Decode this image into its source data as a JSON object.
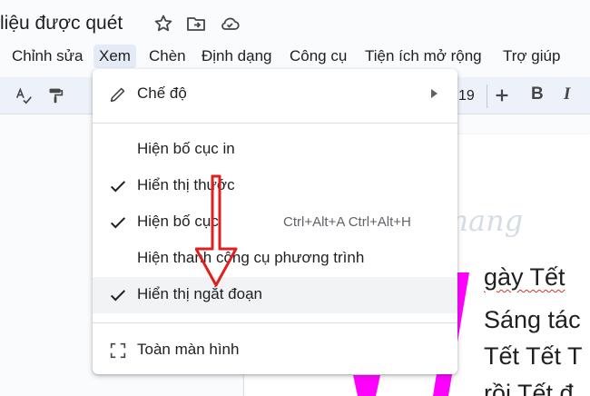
{
  "document": {
    "title": "liệu được quét"
  },
  "menubar": {
    "items": [
      "Chỉnh sửa",
      "Xem",
      "Chèn",
      "Định dạng",
      "Công cụ",
      "Tiện ích mở rộng",
      "Trợ giúp"
    ]
  },
  "toolbar": {
    "font_size": "19",
    "bold_label": "B",
    "italic_label": "I"
  },
  "view_menu": {
    "mode_label": "Chế độ",
    "print_layout_label": "Hiện bố cục in",
    "ruler_label": "Hiển thị thước",
    "ruler_checked": true,
    "layout_label": "Hiện bố cục",
    "layout_checked": true,
    "layout_shortcut": "Ctrl+Alt+A Ctrl+Alt+H",
    "equation_toolbar_label": "Hiện thanh công cụ phương trình",
    "non_printing_label": "Hiển thị ngắt đoạn",
    "non_printing_checked": true,
    "fullscreen_label": "Toàn màn hình"
  },
  "document_body": {
    "line_1": "gày Tết",
    "line_2": "Sáng tác",
    "line_3": "Tết Tết T",
    "line_4": "rồi Tết đ"
  },
  "watermark": {
    "text": "uantrimang"
  },
  "colors": {
    "accent_menu": "#e4ebf6",
    "toolbar_bg": "#edf2fa",
    "arrow_red": "#e02020",
    "magenta": "#ff00ff"
  },
  "icons": [
    "star-icon",
    "move-to-folder-icon",
    "cloud-status-icon",
    "spellcheck-icon",
    "paint-format-icon",
    "pencil-icon",
    "submenu-arrow-icon",
    "check-icon",
    "fullscreen-icon",
    "plus-icon"
  ]
}
